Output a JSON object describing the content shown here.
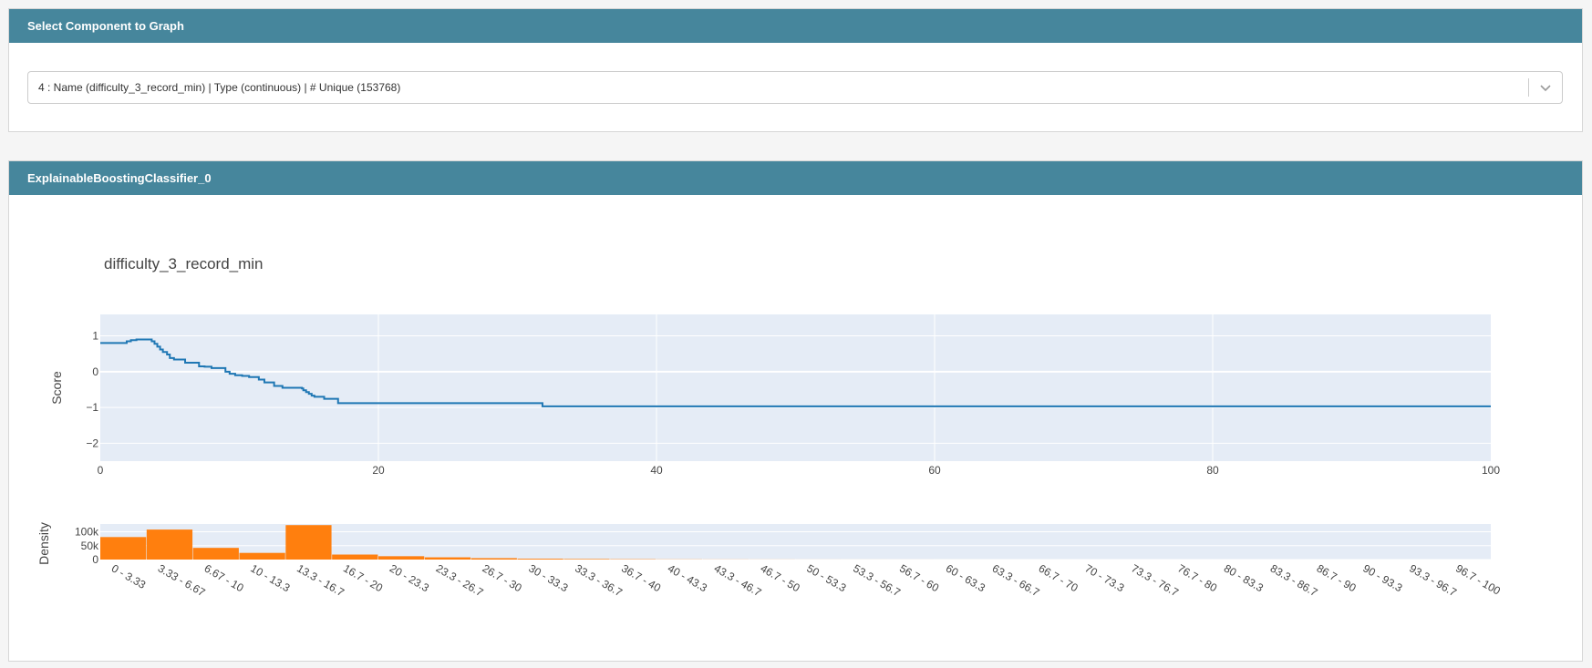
{
  "select_panel": {
    "title": "Select Component to Graph",
    "dropdown_value": "4 : Name (difficulty_3_record_min) | Type (continuous) | # Unique (153768)"
  },
  "graph_panel": {
    "title": "ExplainableBoostingClassifier_0"
  },
  "colors": {
    "header": "#46869c",
    "line": "#1f77b4",
    "bar": "#ff7f0e",
    "plot_bg": "#e5ecf6"
  },
  "chart_data": [
    {
      "type": "line",
      "title": "difficulty_3_record_min",
      "ylabel": "Score",
      "xlim": [
        0,
        100
      ],
      "ylim": [
        -2.5,
        1.6
      ],
      "xticks": [
        0,
        20,
        40,
        60,
        80,
        100
      ],
      "yticks": [
        1,
        0,
        -1,
        -2
      ],
      "ytick_labels": [
        "1",
        "0",
        "−1",
        "−2"
      ],
      "grid": true,
      "step": true,
      "x": [
        0,
        1.9,
        2.2,
        2.6,
        3.7,
        3.9,
        4.1,
        4.3,
        4.5,
        4.8,
        5.0,
        5.3,
        6.1,
        7.1,
        7.5,
        8.0,
        9.0,
        9.3,
        9.7,
        10.2,
        10.7,
        11.4,
        11.8,
        12.5,
        13.1,
        14.5,
        14.6,
        14.8,
        15.0,
        15.2,
        15.4,
        16.1,
        17.1,
        31.8,
        100
      ],
      "y": [
        0.8,
        0.85,
        0.88,
        0.9,
        0.85,
        0.78,
        0.7,
        0.62,
        0.55,
        0.48,
        0.38,
        0.34,
        0.25,
        0.15,
        0.14,
        0.1,
        0.0,
        -0.06,
        -0.1,
        -0.12,
        -0.15,
        -0.22,
        -0.3,
        -0.4,
        -0.45,
        -0.47,
        -0.52,
        -0.57,
        -0.62,
        -0.67,
        -0.7,
        -0.76,
        -0.88,
        -0.97,
        -0.97
      ]
    },
    {
      "type": "bar",
      "ylabel": "Density",
      "yticks": [
        100000,
        50000,
        0
      ],
      "ytick_labels": [
        "100k",
        "50k",
        "0"
      ],
      "ylim": [
        0,
        128000
      ],
      "grid": true,
      "categories": [
        "0 - 3.33",
        "3.33 - 6.67",
        "6.67 - 10",
        "10 - 13.3",
        "13.3 - 16.7",
        "16.7 - 20",
        "20 - 23.3",
        "23.3 - 26.7",
        "26.7 - 30",
        "30 - 33.3",
        "33.3 - 36.7",
        "36.7 - 40",
        "40 - 43.3",
        "43.3 - 46.7",
        "46.7 - 50",
        "50 - 53.3",
        "53.3 - 56.7",
        "56.7 - 60",
        "60 - 63.3",
        "63.3 - 66.7",
        "66.7 - 70",
        "70 - 73.3",
        "73.3 - 76.7",
        "76.7 - 80",
        "80 - 83.3",
        "83.3 - 86.7",
        "86.7 - 90",
        "90 - 93.3",
        "93.3 - 96.7",
        "96.7 - 100"
      ],
      "values": [
        81000,
        108000,
        42000,
        24000,
        124000,
        18000,
        12000,
        8000,
        5000,
        3000,
        2000,
        1200,
        600,
        400,
        250,
        150,
        100,
        80,
        60,
        40,
        30,
        25,
        20,
        15,
        10,
        10,
        8,
        6,
        4,
        3
      ]
    }
  ]
}
